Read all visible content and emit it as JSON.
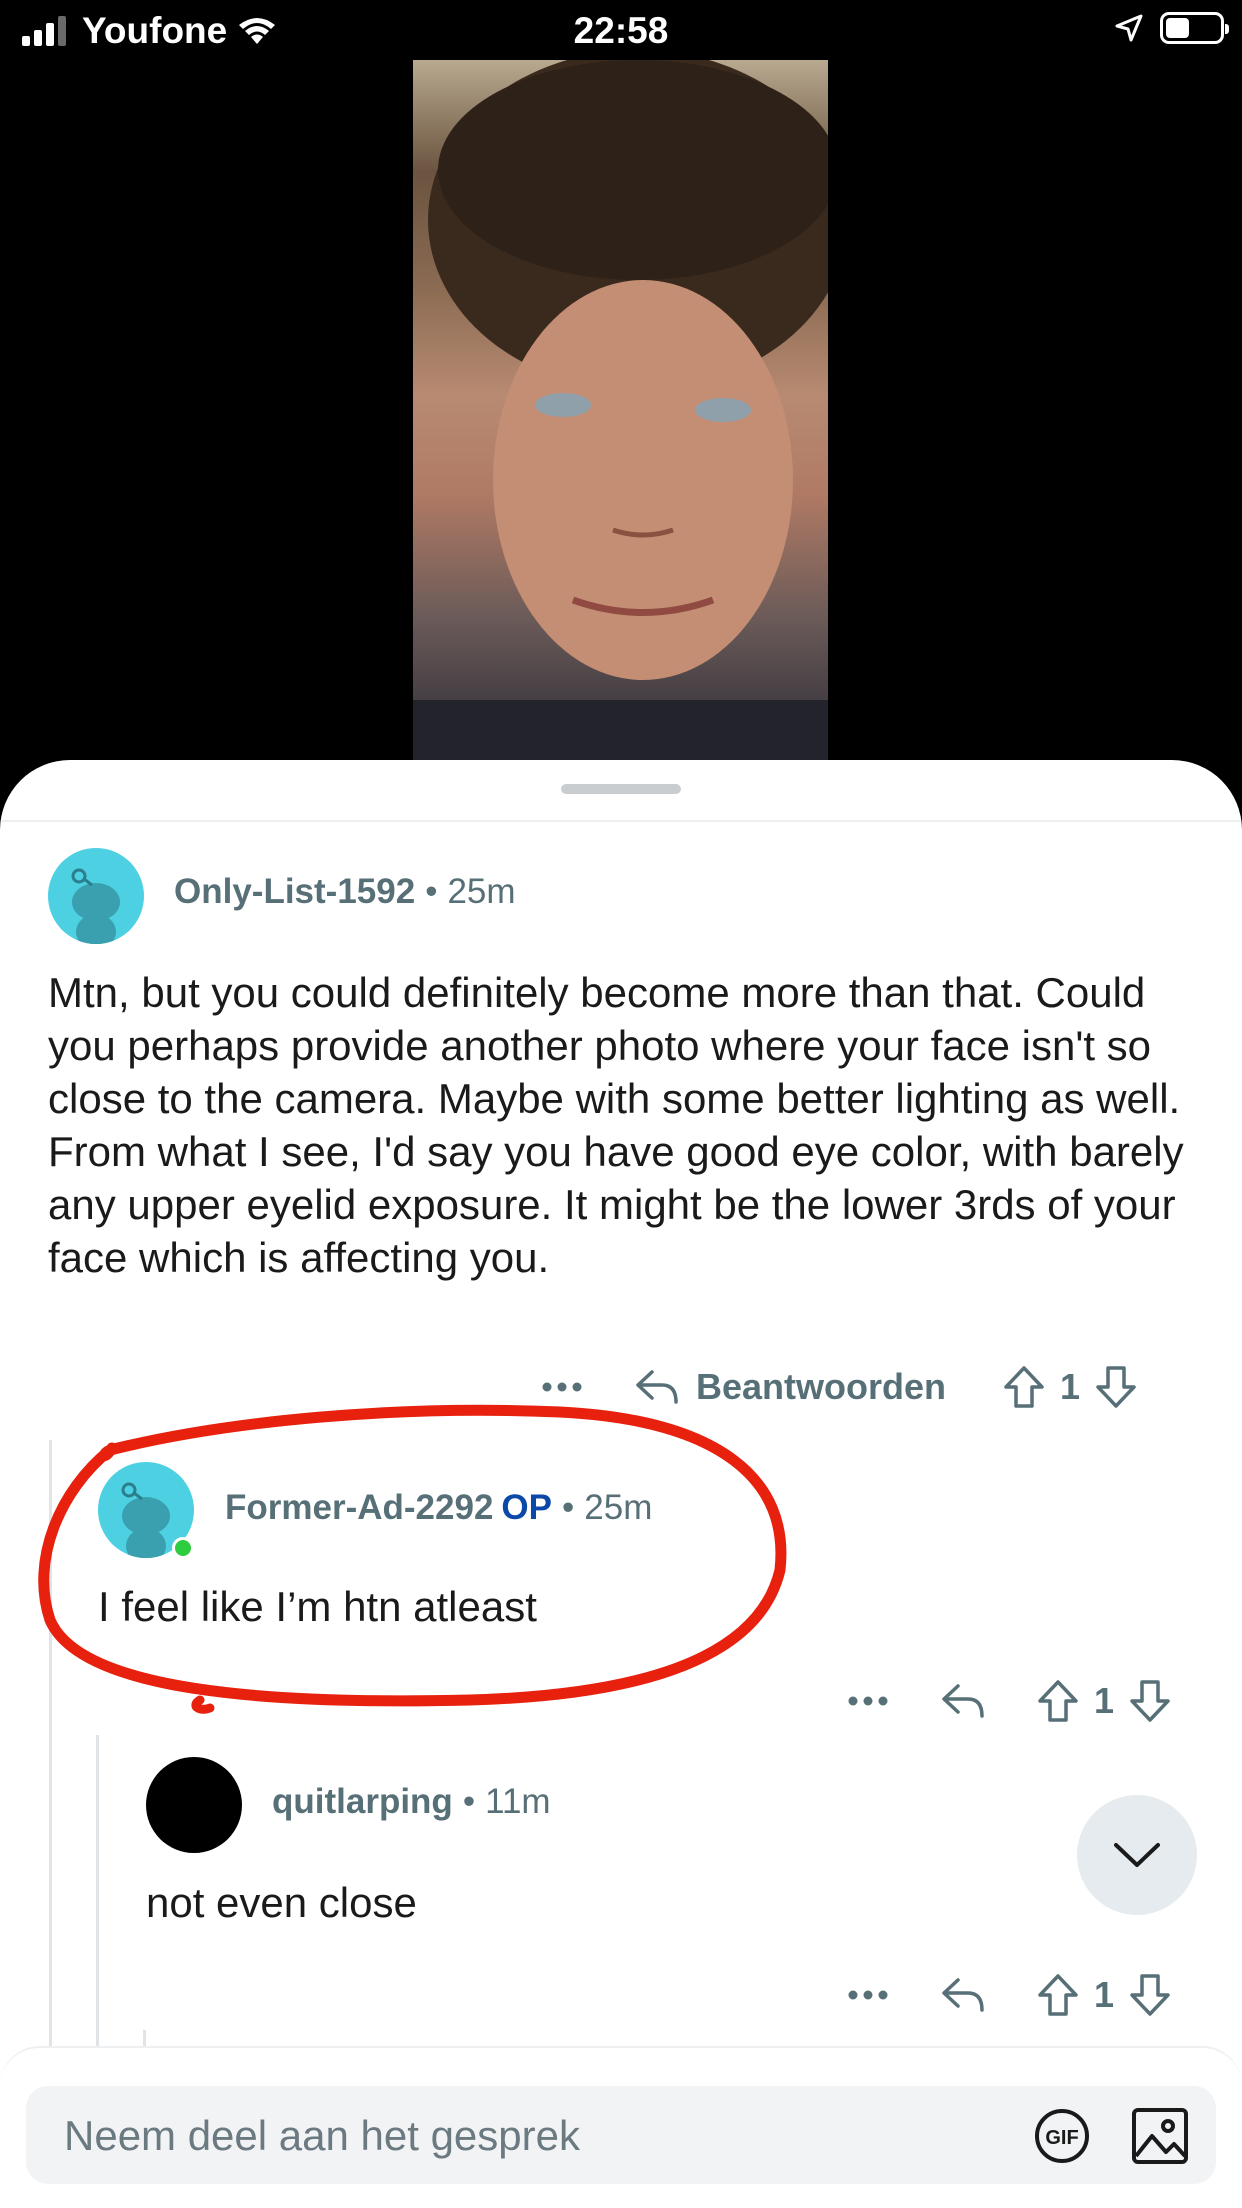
{
  "status_bar": {
    "carrier": "Youfone",
    "time": "22:58",
    "battery_level": 0.45
  },
  "post_image": {
    "icon": "photo"
  },
  "comments": [
    {
      "username": "Only-List-1592",
      "separator": "•",
      "age": "25m",
      "text": "Mtn, but you could definitely become more than that. Could you perhaps provide another photo where your face isn't so close to the camera. Maybe with some better lighting as well. From what I see, I'd say you have good eye color, with barely any upper eyelid exposure. It might be the lower 3rds of your face which is affecting you.",
      "reply_label": "Beantwoorden",
      "votes": "1"
    },
    {
      "username": "Former-Ad-2292",
      "op_badge": "OP",
      "separator": "•",
      "age": "25m",
      "text": "I feel like I’m htn atleast",
      "votes": "1"
    },
    {
      "username": "quitlarping",
      "separator": "•",
      "age": "11m",
      "text": "not even close",
      "votes": "1"
    }
  ],
  "composer": {
    "placeholder": "Neem deel aan het gesprek",
    "gif_label": "GIF"
  },
  "colors": {
    "meta_gray": "#576f76",
    "op_blue": "#0a49a8",
    "annotation_red": "#e8200e",
    "avatar_teal": "#4dd0e1"
  }
}
